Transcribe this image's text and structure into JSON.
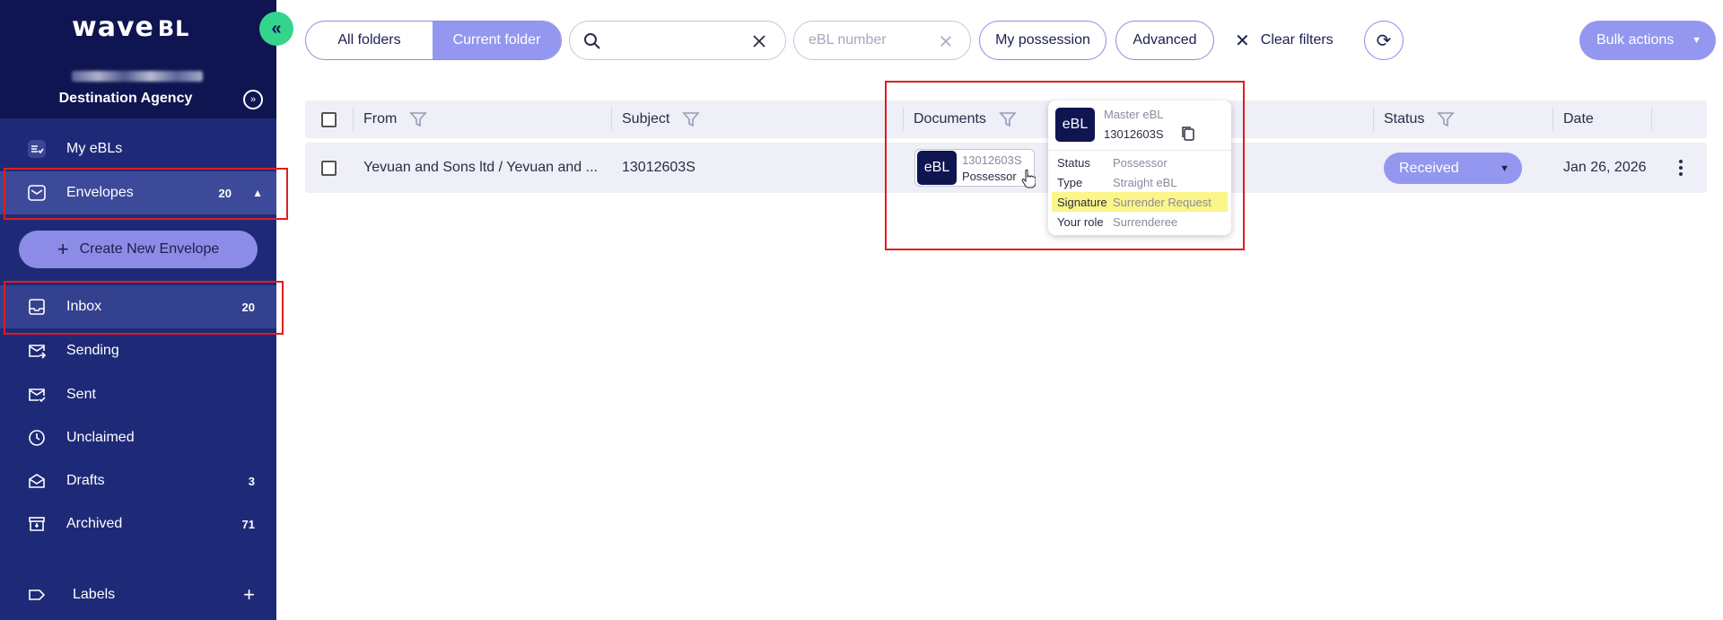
{
  "sidebar": {
    "logo": "wave",
    "logo_suffix": "BL",
    "agency_name": "Destination Agency",
    "items": [
      {
        "label": "My eBLs",
        "icon": "list-check-icon"
      },
      {
        "label": "Envelopes",
        "count": "20",
        "icon": "envelope-icon"
      },
      {
        "label": "Inbox",
        "count": "20",
        "icon": "inbox-icon"
      },
      {
        "label": "Sending",
        "icon": "mail-send-icon"
      },
      {
        "label": "Sent",
        "icon": "mail-check-icon"
      },
      {
        "label": "Unclaimed",
        "icon": "clock-icon"
      },
      {
        "label": "Drafts",
        "count": "3",
        "icon": "drafts-icon"
      },
      {
        "label": "Archived",
        "count": "71",
        "icon": "archive-icon"
      }
    ],
    "create_button": "Create New Envelope",
    "labels": "Labels"
  },
  "toolbar": {
    "all_folders": "All folders",
    "current_folder": "Current folder",
    "search_placeholder": "",
    "ebl_placeholder": "eBL number",
    "my_possession": "My possession",
    "advanced": "Advanced",
    "clear_filters": "Clear filters",
    "bulk_actions": "Bulk actions"
  },
  "table": {
    "headers": {
      "from": "From",
      "subject": "Subject",
      "documents": "Documents",
      "status": "Status",
      "date": "Date"
    },
    "rows": [
      {
        "from": "Yevuan and Sons ltd / Yevuan and ...",
        "subject": "13012603S",
        "document": {
          "badge": "eBL",
          "number": "13012603S",
          "role": "Possessor"
        },
        "status": "Received",
        "date": "Jan 26, 2026"
      }
    ]
  },
  "popover": {
    "badge": "eBL",
    "type": "Master eBL",
    "number": "13012603S",
    "rows": [
      {
        "key": "Status",
        "value": "Possessor"
      },
      {
        "key": "Type",
        "value": "Straight eBL"
      },
      {
        "key": "Signature",
        "value": "Surrender Request"
      },
      {
        "key": "Your role",
        "value": "Surrenderee"
      }
    ]
  },
  "colors": {
    "sidebar": "#1e2a78",
    "sidebar_header": "#0e1550",
    "accent": "#9497ef",
    "collapse": "#35d48d",
    "highlight": "#fbf58a",
    "annotation": "#e01d1d"
  }
}
